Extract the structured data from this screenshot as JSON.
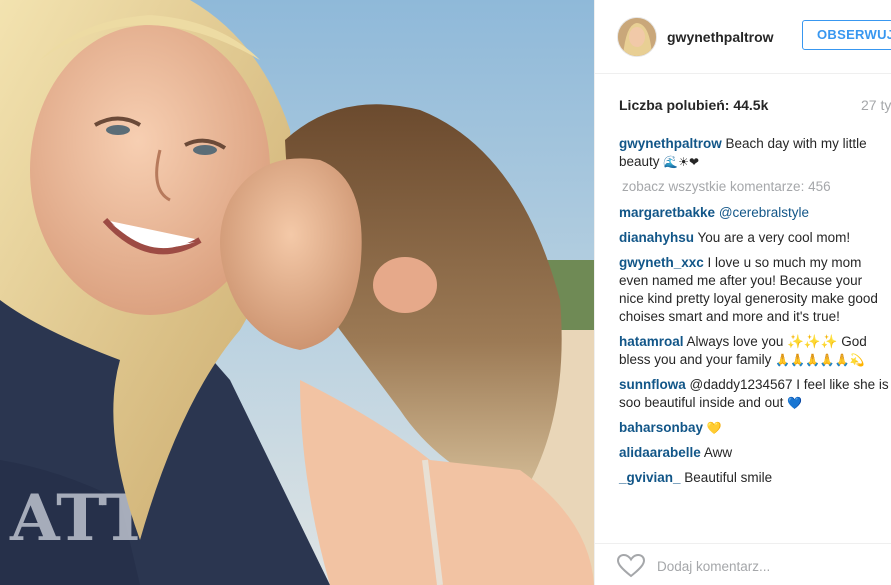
{
  "post": {
    "username": "gwynethpaltrow",
    "follow_label": "OBSERWUJ",
    "likes_text": "Liczba polubień: 44.5k",
    "time_text": "27 ty"
  },
  "caption": {
    "user": "gwynethpaltrow",
    "text": " Beach day with my little beauty ",
    "emoji": "🌊☀❤"
  },
  "view_all_label": "zobacz wszystkie komentarze: 456",
  "comments": [
    {
      "user": "margaretbakke",
      "text": " @cerebralstyle",
      "emoji": ""
    },
    {
      "user": "dianahyhsu",
      "text": " You are a very cool mom!",
      "emoji": ""
    },
    {
      "user": "gwyneth_xxc",
      "text": " I love u so much my mom even named me after you! Because your nice kind pretty loyal generosity make good choises smart and more and it's true!",
      "emoji": ""
    },
    {
      "user": "hatamroal",
      "text": " Always love you ✨✨✨ God bless you and your family ",
      "emoji": "🙏🙏🙏🙏🙏💫"
    },
    {
      "user": "sunnflowa",
      "text": " @daddy1234567 I feel like she is soo beautiful inside and out ",
      "emoji": "💙"
    },
    {
      "user": "baharsonbay",
      "text": " ",
      "emoji": "💛"
    },
    {
      "user": "alidaarabelle",
      "text": " Aww",
      "emoji": ""
    },
    {
      "user": "_gvivian_",
      "text": " Beautiful smile",
      "emoji": ""
    }
  ],
  "footer": {
    "comment_placeholder": "Dodaj komentarz..."
  },
  "icons": {
    "like": "heart-outline-icon",
    "avatar": "profile-photo"
  },
  "colors": {
    "username": "#125688",
    "button": "#3897f0",
    "muted": "#a5a7aa"
  }
}
